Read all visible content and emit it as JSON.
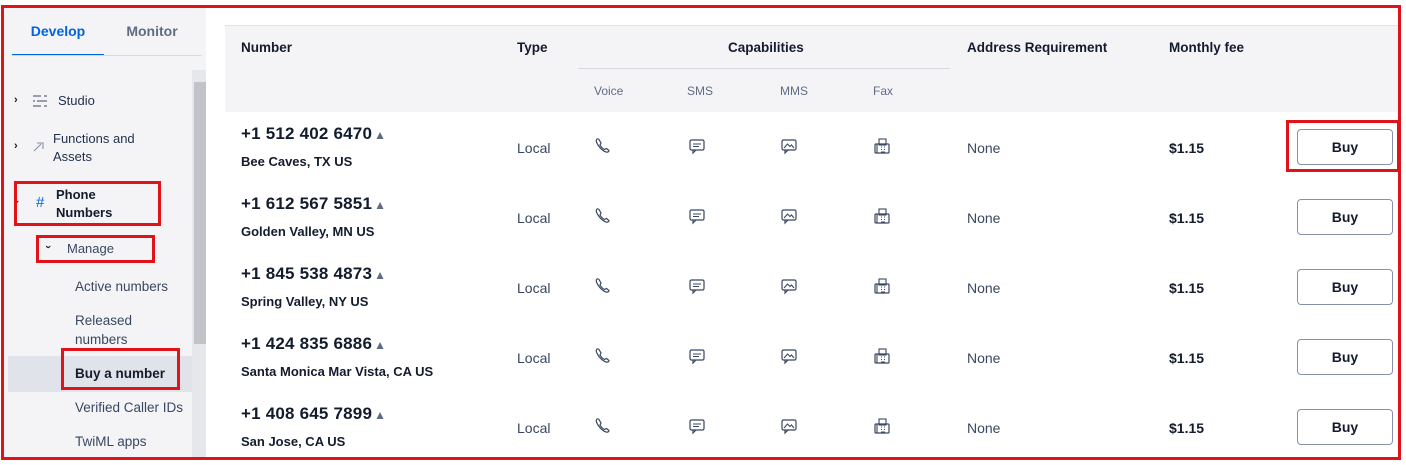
{
  "sidebar": {
    "tabs": [
      {
        "label": "Develop",
        "active": true
      },
      {
        "label": "Monitor",
        "active": false
      }
    ],
    "items": {
      "studio": "Studio",
      "functions": "Functions and Assets",
      "phone_numbers": "Phone Numbers",
      "manage": "Manage"
    },
    "subitems": {
      "active_numbers": "Active numbers",
      "released_numbers": "Released numbers",
      "buy_a_number": "Buy a number",
      "verified_caller_ids": "Verified Caller IDs",
      "twiml_apps": "TwiML apps"
    }
  },
  "table": {
    "headers": {
      "number": "Number",
      "type": "Type",
      "capabilities": "Capabilities",
      "address": "Address Requirement",
      "fee": "Monthly fee"
    },
    "capability_headers": {
      "voice": "Voice",
      "sms": "SMS",
      "mms": "MMS",
      "fax": "Fax"
    },
    "rows": [
      {
        "number": "+1 512 402 6470",
        "location": "Bee Caves, TX US",
        "type": "Local",
        "address": "None",
        "fee": "$1.15",
        "action": "Buy"
      },
      {
        "number": "+1 612 567 5851",
        "location": "Golden Valley, MN US",
        "type": "Local",
        "address": "None",
        "fee": "$1.15",
        "action": "Buy"
      },
      {
        "number": "+1 845 538 4873",
        "location": "Spring Valley, NY US",
        "type": "Local",
        "address": "None",
        "fee": "$1.15",
        "action": "Buy"
      },
      {
        "number": "+1 424 835 6886",
        "location": "Santa Monica Mar Vista, CA US",
        "type": "Local",
        "address": "None",
        "fee": "$1.15",
        "action": "Buy"
      },
      {
        "number": "+1 408 645 7899",
        "location": "San Jose, CA US",
        "type": "Local",
        "address": "None",
        "fee": "$1.15",
        "action": "Buy"
      }
    ]
  },
  "icons": {
    "row_capabilities": [
      "phone-icon",
      "chat-icon",
      "image-message-icon",
      "fax-icon"
    ],
    "studio": "studio-flow-icon",
    "functions": "functions-icon",
    "phone_numbers": "hash-icon",
    "sort": "caret-up-icon"
  },
  "colors": {
    "accent": "#0263e0",
    "highlight_box": "#e0131a"
  }
}
